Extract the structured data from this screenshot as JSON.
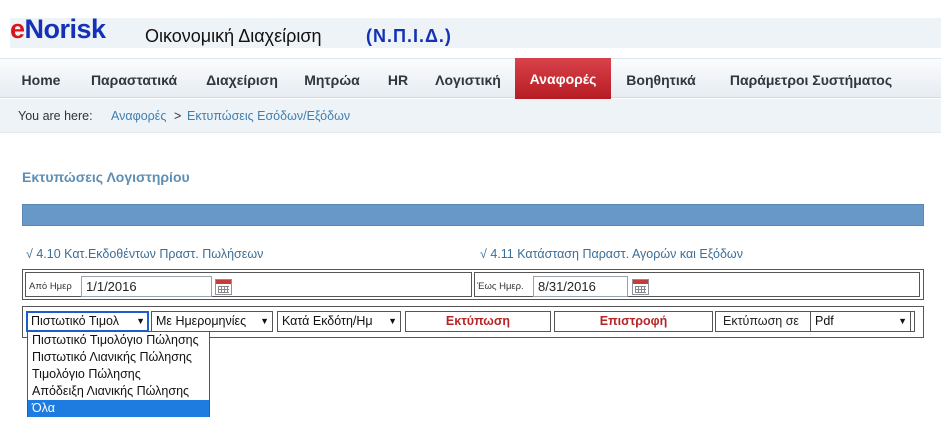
{
  "brand": {
    "logo_e": "e",
    "logo_rest": "Norisk",
    "app_title": "Οικονομική Διαχείριση",
    "org": "(Ν.Π.Ι.Δ.)"
  },
  "nav": {
    "items": [
      {
        "label": "Home"
      },
      {
        "label": "Παραστατικά"
      },
      {
        "label": "Διαχείριση"
      },
      {
        "label": "Μητρώα"
      },
      {
        "label": "HR"
      },
      {
        "label": "Λογιστική"
      },
      {
        "label": "Αναφορές"
      },
      {
        "label": "Βοηθητικά"
      },
      {
        "label": "Παράμετροι Συστήματος"
      }
    ],
    "active_color": "#c2262d"
  },
  "breadcrumb": {
    "label": "You are here:",
    "items": [
      "Αναφορές",
      "Εκτυπώσεις Εσόδων/Εξόδων"
    ],
    "separator": ">"
  },
  "section": {
    "title": "Εκτυπώσεις Λογιστηρίου"
  },
  "reports": {
    "left": "√ 4.10 Κατ.Εκδοθέντων Πραστ. Πωλήσεων",
    "right": "√ 4.11 Κατάσταση Παραστ. Αγορών και Εξόδων"
  },
  "dates": {
    "from_label": "Από Ημερ",
    "from_value": "1/1/2016",
    "to_label": "Έως Ημερ.",
    "to_value": "8/31/2016"
  },
  "filters": {
    "doc_type_value": "Πιστωτικό Τιμολ",
    "date_mode_value": "Με Ημερομηνίες",
    "group_value": "Κατά Εκδότη/Ημ",
    "print_button": "Εκτύπωση",
    "back_button": "Επιστροφή",
    "print_as_label": "Εκτύπωση σε",
    "format_value": "Pdf"
  },
  "dropdown": {
    "options": [
      "Πιστωτικό Τιμολόγιο Πώλησης",
      "Πιστωτικό Λιανικής Πώλησης",
      "Τιμολόγιο Πώλησης",
      "Απόδειξη Λιανικής Πώλησης",
      "Όλα"
    ],
    "highlighted": "Όλα"
  }
}
